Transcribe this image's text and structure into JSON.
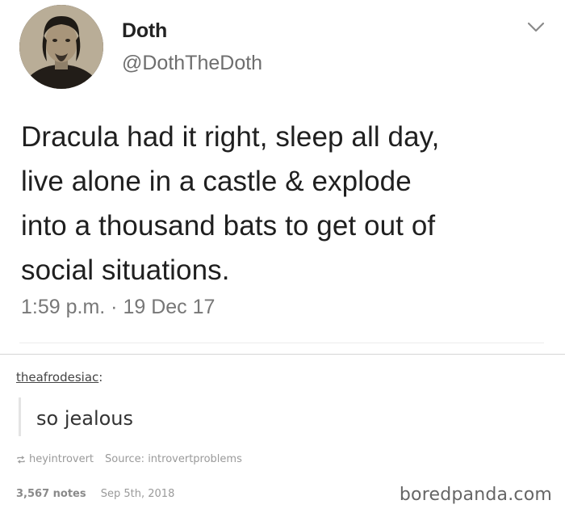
{
  "tweet": {
    "display_name": "Doth",
    "handle": "@DothTheDoth",
    "text_lines": [
      "Dracula had it right, sleep all day,",
      "live alone in a castle & explode",
      "into a thousand bats to get out of",
      "social situations."
    ],
    "timestamp": "1:59 p.m. · 19 Dec 17",
    "menu_icon": "chevron-down-icon"
  },
  "reblog": {
    "username": "theafrodesiac",
    "separator": ":",
    "comment": "so jealous"
  },
  "post_meta": {
    "reblogged_from": "heyintrovert",
    "source_label": "Source: introvertproblems",
    "notes": "3,567 notes",
    "date": "Sep 5th, 2018"
  },
  "watermark": "boredpanda.com",
  "colors": {
    "text": "#1f1f1f",
    "muted": "#777777",
    "meta": "#9a9a9a",
    "divider": "#d6d6d6"
  }
}
